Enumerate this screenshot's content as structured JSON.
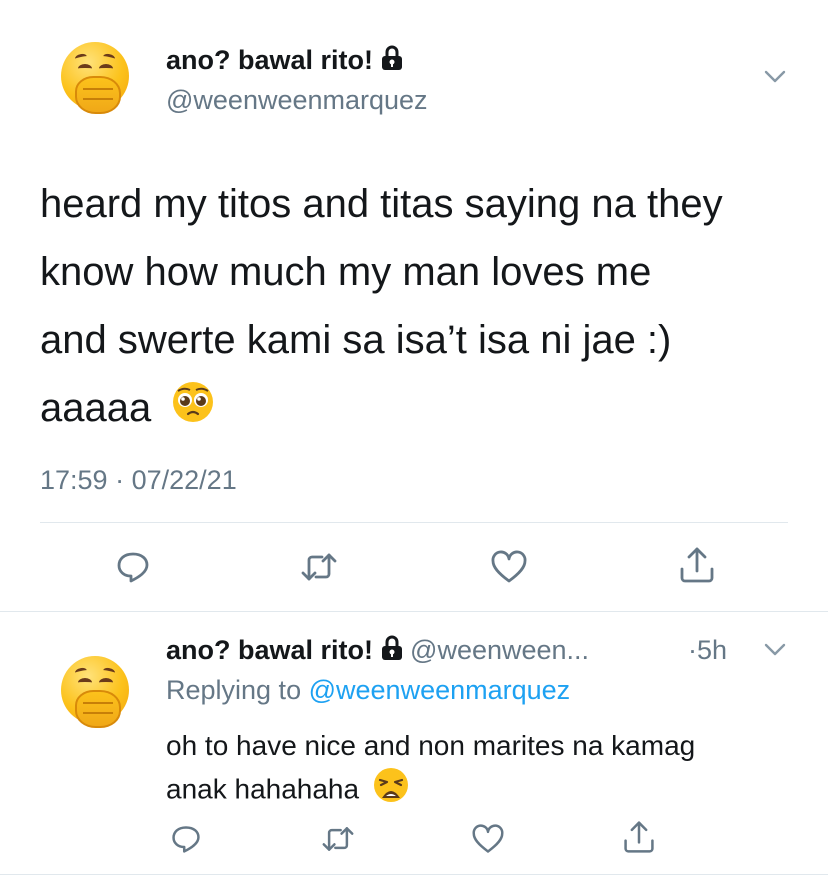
{
  "main_tweet": {
    "display_name": "ano? bawal rito!",
    "handle": "@weenweenmarquez",
    "text_lines": [
      "heard my titos and titas saying na they",
      "know how much my man loves me",
      "and swerte kami sa isa’t isa ni jae :)",
      "aaaaa"
    ],
    "text_emoji": "pleading-face",
    "time": "17:59",
    "separator": "·",
    "date": "07/22/21"
  },
  "reply_tweet": {
    "display_name": "ano? bawal rito!",
    "handle": "@weenween...",
    "separator": "·",
    "age": "5h",
    "replying_prefix": "Replying to",
    "replying_handle": "@weenweenmarquez",
    "text_lines": [
      "oh to have nice and non marites na kamag",
      "anak hahahaha"
    ],
    "text_emoji": "weary-face"
  },
  "icons": {
    "avatar": "yawning-face-emoji",
    "lock": "lock-icon",
    "chevron": "chevron-down-icon",
    "reply": "reply-icon",
    "retweet": "retweet-icon",
    "like": "heart-icon",
    "share": "share-icon"
  },
  "colors": {
    "text": "#14171a",
    "secondary": "#657786",
    "link": "#1da1f2",
    "divider": "#e1e8ed",
    "icon": "#657786"
  }
}
